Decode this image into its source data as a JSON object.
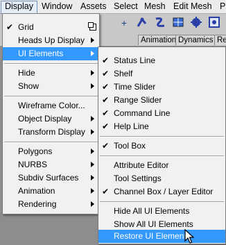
{
  "menubar": {
    "items": [
      "Display",
      "Window",
      "Assets",
      "Select",
      "Mesh",
      "Edit Mesh",
      "P"
    ]
  },
  "shelf_tabs": [
    "Animation",
    "Dynamics",
    "Re"
  ],
  "display_menu": {
    "items": [
      {
        "label": "Grid",
        "checked": true,
        "option_box": true
      },
      {
        "label": "Heads Up Display",
        "submenu": true
      },
      {
        "label": "UI Elements",
        "submenu": true,
        "highlighted": true
      },
      {
        "label": "Hide",
        "submenu": true
      },
      {
        "label": "Show",
        "submenu": true
      },
      {
        "label": "Wireframe Color..."
      },
      {
        "label": "Object Display",
        "submenu": true
      },
      {
        "label": "Transform Display",
        "submenu": true
      },
      {
        "label": "Polygons",
        "submenu": true
      },
      {
        "label": "NURBS",
        "submenu": true
      },
      {
        "label": "Subdiv Surfaces",
        "submenu": true
      },
      {
        "label": "Animation",
        "submenu": true
      },
      {
        "label": "Rendering",
        "submenu": true
      }
    ]
  },
  "ui_elements_menu": {
    "items": [
      {
        "label": "Status Line",
        "checked": true
      },
      {
        "label": "Shelf",
        "checked": true
      },
      {
        "label": "Time Slider",
        "checked": true
      },
      {
        "label": "Range Slider",
        "checked": true
      },
      {
        "label": "Command Line",
        "checked": true
      },
      {
        "label": "Help Line",
        "checked": true
      },
      {
        "label": "Tool Box",
        "checked": true
      },
      {
        "label": "Attribute Editor"
      },
      {
        "label": "Tool Settings"
      },
      {
        "label": "Channel Box / Layer Editor",
        "checked": true
      },
      {
        "label": "Hide All UI Elements"
      },
      {
        "label": "Show All UI Elements"
      },
      {
        "label": "Restore UI Elements",
        "highlighted": true
      }
    ]
  },
  "check_glyph": "✔",
  "colors": {
    "highlight": "#3399ff",
    "menu_bg": "#f1f1f1"
  }
}
